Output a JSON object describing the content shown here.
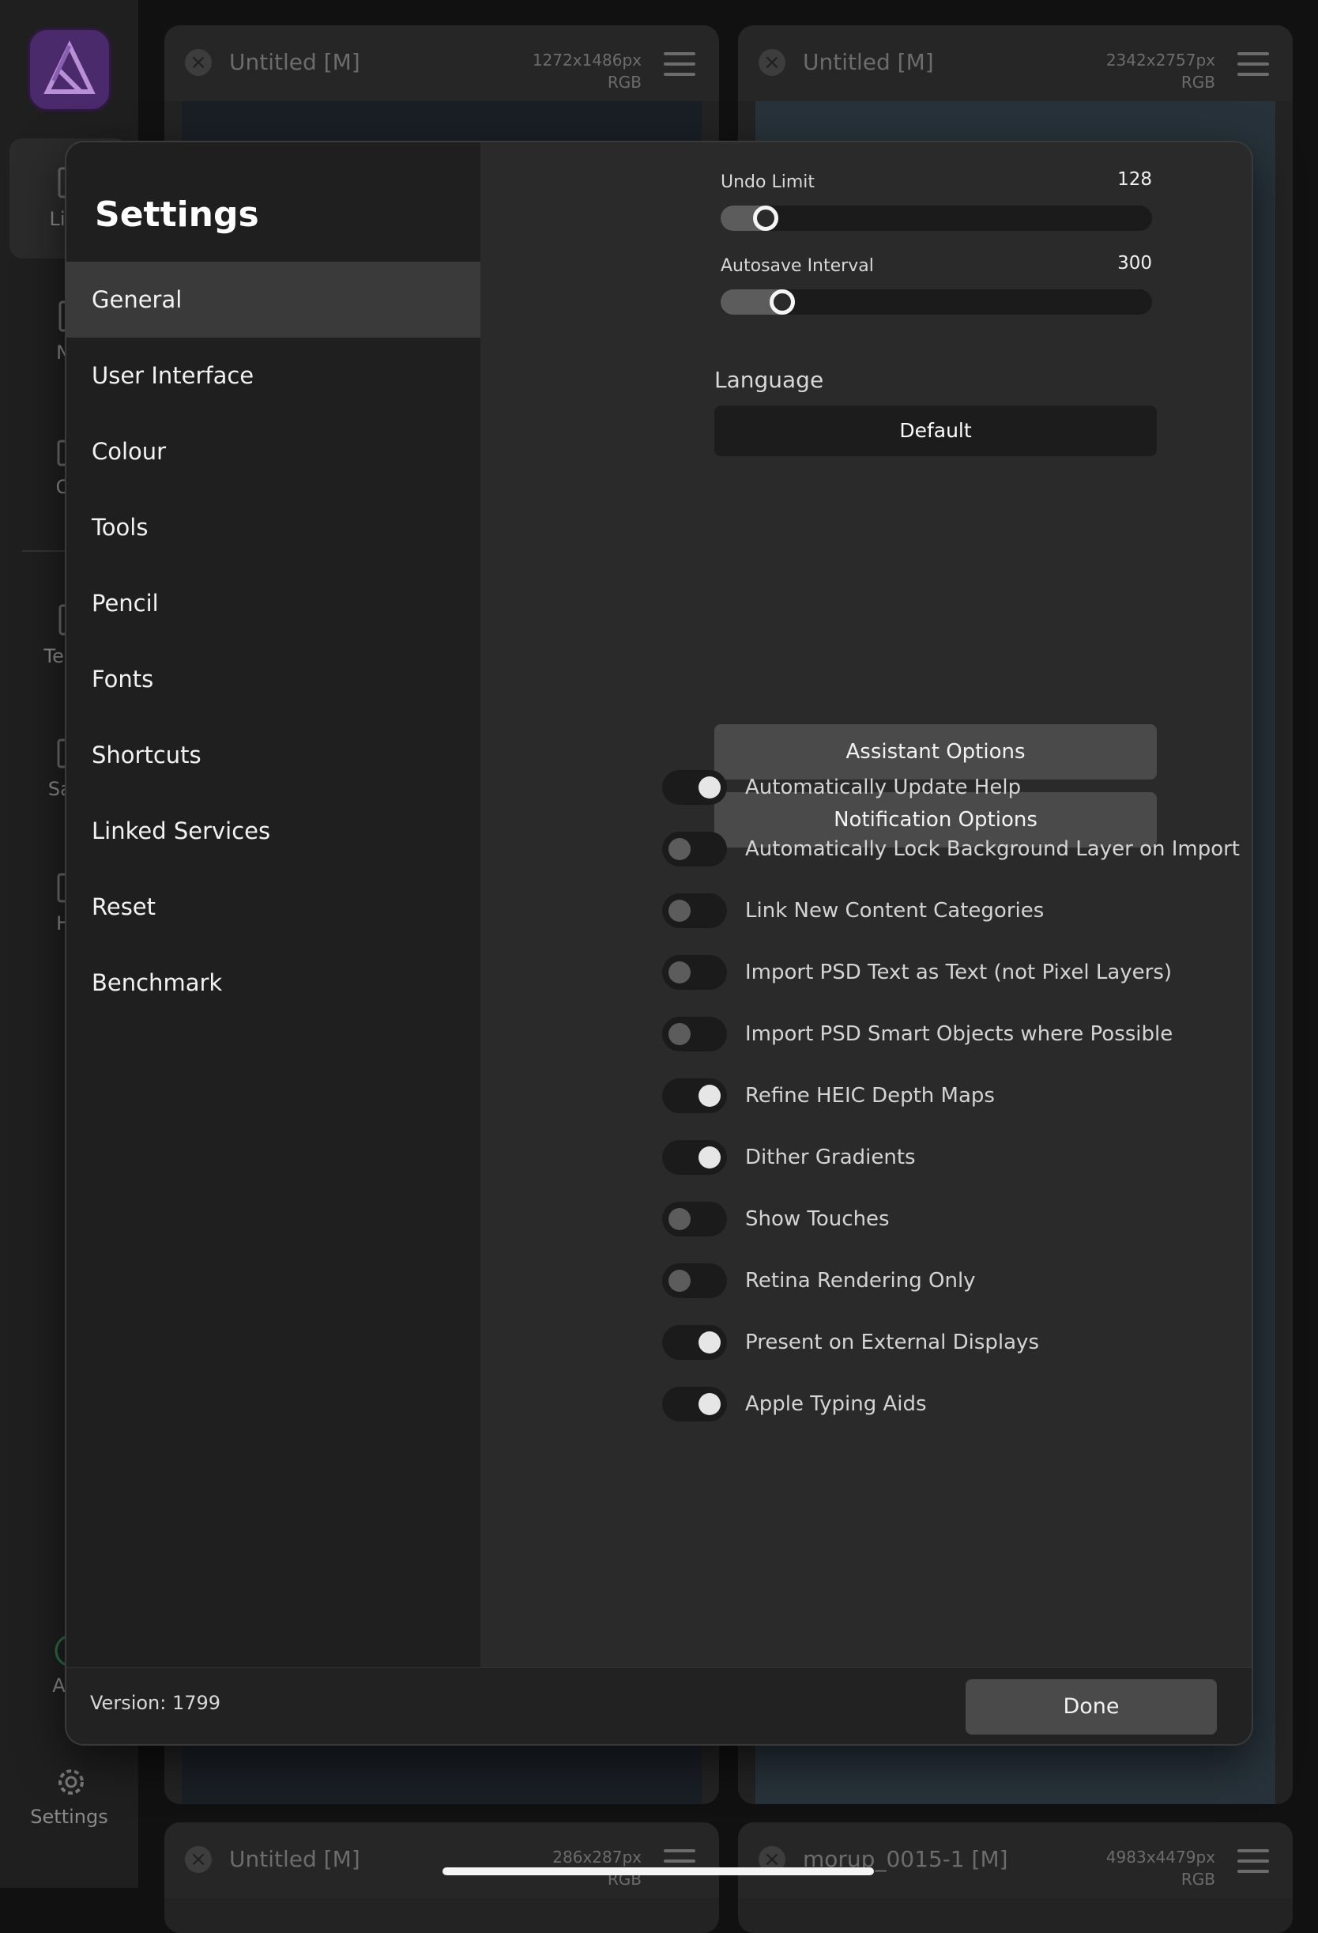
{
  "background": {
    "sidebar": {
      "items": [
        {
          "label": "Live",
          "icon": "document-icon"
        },
        {
          "label": "Ne",
          "icon": "new-document-icon"
        },
        {
          "label": "Op",
          "icon": "open-icon"
        },
        {
          "label": "Temp",
          "icon": "template-icon"
        },
        {
          "label": "Sam",
          "icon": "samples-icon"
        },
        {
          "label": "He",
          "icon": "help-icon"
        },
        {
          "label": "Acc",
          "icon": "account-icon"
        }
      ],
      "settings_label": "Settings"
    },
    "documents": [
      {
        "title": "Untitled [M]",
        "size": "1272x1486px",
        "mode": "RGB"
      },
      {
        "title": "Untitled [M]",
        "size": "2342x2757px",
        "mode": "RGB"
      },
      {
        "title": "Untitled [M]",
        "size": "286x287px",
        "mode": "RGB"
      },
      {
        "title": "morup_0015-1 [M]",
        "size": "4983x4479px",
        "mode": "RGB"
      }
    ]
  },
  "settings": {
    "title": "Settings",
    "nav": [
      {
        "label": "General",
        "active": true
      },
      {
        "label": "User Interface"
      },
      {
        "label": "Colour"
      },
      {
        "label": "Tools"
      },
      {
        "label": "Pencil"
      },
      {
        "label": "Fonts"
      },
      {
        "label": "Shortcuts"
      },
      {
        "label": "Linked Services"
      },
      {
        "label": "Reset"
      },
      {
        "label": "Benchmark"
      }
    ],
    "undo_limit": {
      "label": "Undo Limit",
      "value": "128",
      "fraction": 0.08
    },
    "autosave_interval": {
      "label": "Autosave Interval",
      "value": "300",
      "fraction": 0.12
    },
    "language": {
      "label": "Language",
      "value": "Default"
    },
    "buttons": {
      "assistant": "Assistant Options",
      "notification": "Notification Options"
    },
    "toggles": [
      {
        "label": "Automatically Update Help",
        "on": true
      },
      {
        "label": "Automatically Lock Background Layer on Import",
        "on": false
      },
      {
        "label": "Link New Content Categories",
        "on": false
      },
      {
        "label": "Import PSD Text as Text (not Pixel Layers)",
        "on": false
      },
      {
        "label": "Import PSD Smart Objects where Possible",
        "on": false
      },
      {
        "label": "Refine HEIC Depth Maps",
        "on": true
      },
      {
        "label": "Dither Gradients",
        "on": true
      },
      {
        "label": "Show Touches",
        "on": false
      },
      {
        "label": "Retina Rendering Only",
        "on": false
      },
      {
        "label": "Present on External Displays",
        "on": true
      },
      {
        "label": "Apple Typing Aids",
        "on": true
      }
    ],
    "version": "Version: 1799",
    "done_label": "Done"
  }
}
